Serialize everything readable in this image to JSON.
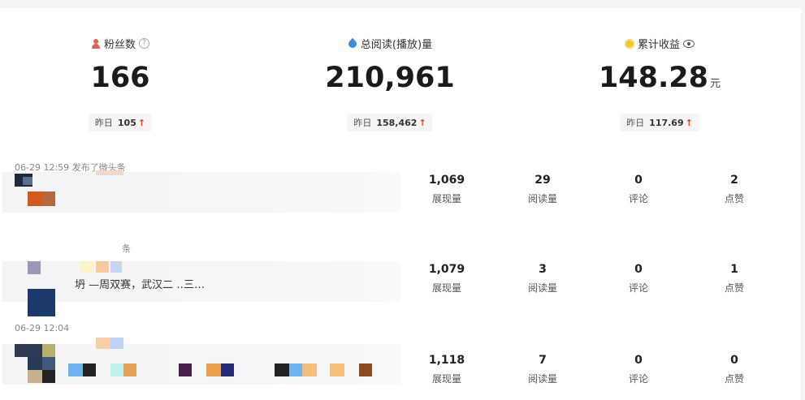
{
  "stats": {
    "fans": {
      "label": "粉丝数",
      "value": "166",
      "yesterday_label": "昨日",
      "yesterday_value": "105",
      "trend": "↑",
      "icon": "person-icon",
      "help": "?"
    },
    "reads": {
      "label": "总阅读(播放)量",
      "value": "210,961",
      "yesterday_label": "昨日",
      "yesterday_value": "158,462",
      "trend": "↑",
      "icon": "drop-icon"
    },
    "earnings": {
      "label": "累计收益",
      "value": "148.28",
      "unit": "元",
      "yesterday_label": "昨日",
      "yesterday_value": "117.69",
      "trend": "↑",
      "icon": "coin-icon"
    }
  },
  "posts": [
    {
      "meta": "06-29 12:59  发布了微头条",
      "title": "",
      "impressions": "1,069",
      "impressions_label": "展现量",
      "reads": "29",
      "reads_label": "阅读量",
      "comments": "0",
      "comments_label": "评论",
      "likes": "2",
      "likes_label": "点赞"
    },
    {
      "meta": "条",
      "title": "坍  —周双赛，武汉二                                      ‥三…",
      "impressions": "1,079",
      "impressions_label": "展现量",
      "reads": "3",
      "reads_label": "阅读量",
      "comments": "0",
      "comments_label": "评论",
      "likes": "1",
      "likes_label": "点赞"
    },
    {
      "meta": "06-29 12:04",
      "title": "",
      "impressions": "1,118",
      "impressions_label": "展现量",
      "reads": "7",
      "reads_label": "阅读量",
      "comments": "0",
      "comments_label": "评论",
      "likes": "0",
      "likes_label": "点赞"
    }
  ],
  "colors": {
    "up_arrow": "#e0412b",
    "accent_blue": "#3b8ce0",
    "coin": "#f3c531",
    "person": "#e8604f"
  }
}
